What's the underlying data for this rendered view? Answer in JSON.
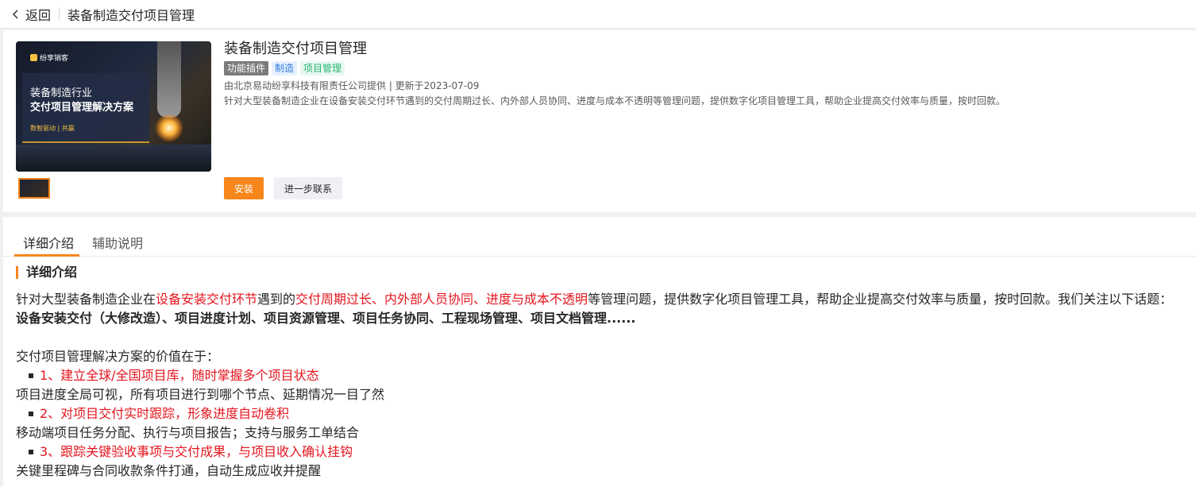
{
  "topbar": {
    "back_label": "返回",
    "title": "装备制造交付项目管理"
  },
  "product": {
    "title": "装备制造交付项目管理",
    "tags": [
      "功能插件",
      "制造",
      "项目管理"
    ],
    "meta": "由北京易动纷享科技有限责任公司提供 | 更新于2023-07-09",
    "description": "针对大型装备制造企业在设备安装交付环节遇到的交付周期过长、内外部人员协同、进度与成本不透明等管理问题，提供数字化项目管理工具，帮助企业提高交付效率与质量，按时回款。",
    "cover": {
      "logo": "纷享销客",
      "line1": "装备制造行业",
      "line2": "交付项目管理解决方案",
      "line3": "数智驱动 | 共赢"
    },
    "install_label": "安装",
    "contact_label": "进一步联系"
  },
  "tabs": [
    "详细介绍",
    "辅助说明"
  ],
  "detail": {
    "section_title": "详细介绍",
    "intro_a": "针对大型装备制造企业在",
    "intro_b": "设备安装交付环节",
    "intro_c": "遇到的",
    "intro_d": "交付周期过长、内外部人员协同、进度与成本不透明",
    "intro_e": "等管理问题，提供数字化项目管理工具，帮助企业提高交付效率与质量，按时回款。我们关注以下话题：",
    "topics": "设备安装交付（大修改造）、项目进度计划、项目资源管理、项目任务协同、工程现场管理、项目文档管理......",
    "value_heading": "交付项目管理解决方案的价值在于：",
    "value1": "1、建立全球/全国项目库，随时掌握多个项目状态",
    "value1_desc": "项目进度全局可视，所有项目进行到哪个节点、延期情况一目了然",
    "value2": "2、对项目交付实时跟踪，形象进度自动卷积",
    "value2_desc": "移动端项目任务分配、执行与项目报告；支持与服务工单结合",
    "value3": "3、跟踪关键验收事项与交付成果，与项目收入确认挂钩",
    "value3_desc": "关键里程碑与合同收款条件打通，自动生成应收并提醒"
  }
}
